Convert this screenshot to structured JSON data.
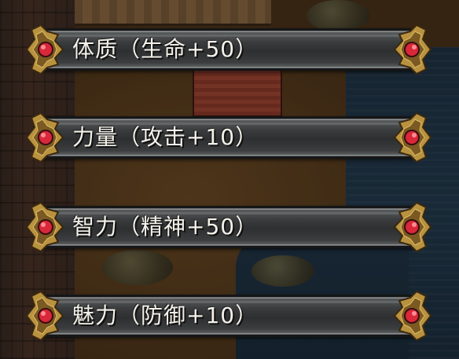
{
  "options": [
    {
      "label": "体质（生命+50）"
    },
    {
      "label": "力量（攻击+10）"
    },
    {
      "label": "智力（精神+50）"
    },
    {
      "label": "魅力（防御+10）"
    }
  ],
  "colors": {
    "bar_dark": "#2d2f30",
    "bar_light": "#8d8f8f",
    "gold": "#c9a14a",
    "gem": "#d8283a",
    "text": "#f4f1ea"
  },
  "icons": {
    "ornament": "gold-ornament-with-red-gem-icon"
  }
}
